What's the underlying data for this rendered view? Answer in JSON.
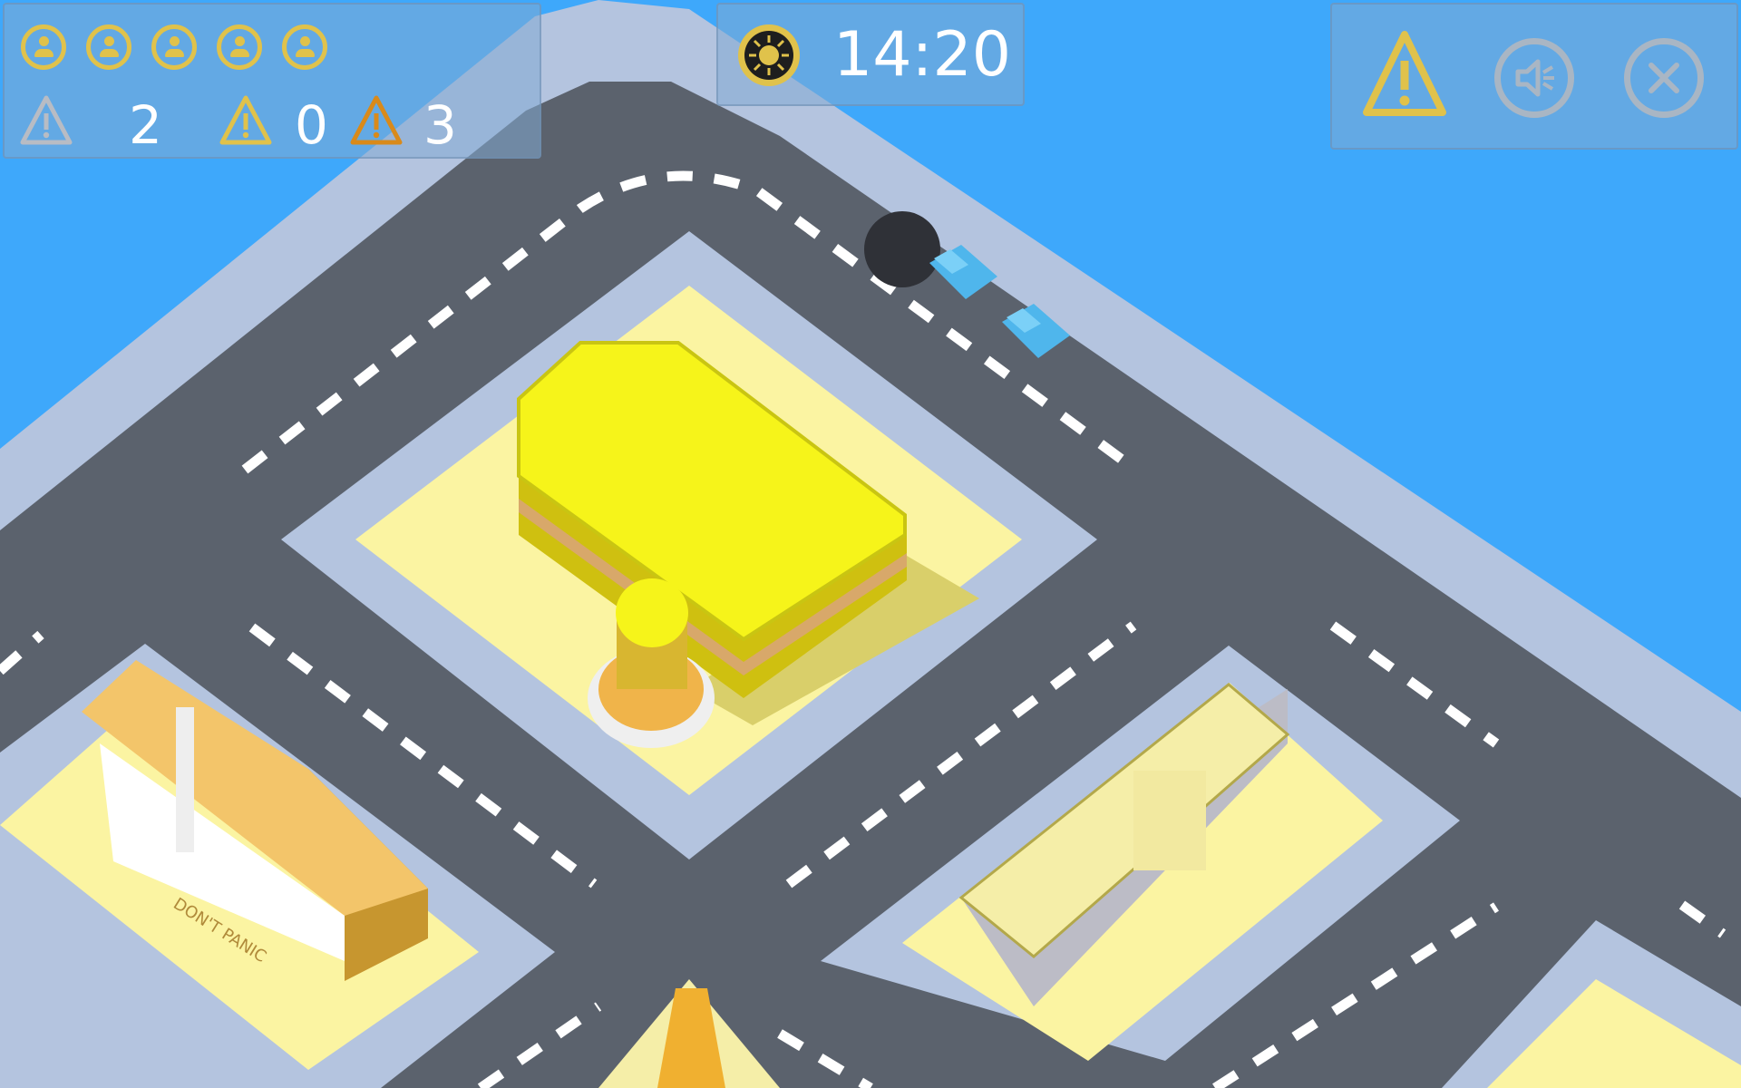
{
  "hud": {
    "citizens": [
      {
        "icon": "citizen-icon"
      },
      {
        "icon": "citizen-icon"
      },
      {
        "icon": "citizen-icon"
      },
      {
        "icon": "citizen-icon"
      },
      {
        "icon": "citizen-icon"
      }
    ],
    "alerts": {
      "low": {
        "icon": "warning-gray-icon",
        "count": "2",
        "color": "#b8bcc4"
      },
      "medium": {
        "icon": "warning-yellow-icon",
        "count": "0",
        "color": "#e0c24b"
      },
      "high": {
        "icon": "warning-orange-icon",
        "count": "3",
        "color": "#d98a1a"
      }
    },
    "clock": {
      "icon": "sun-icon",
      "time": "14:20"
    },
    "buttons": {
      "alert": {
        "icon": "warning-icon"
      },
      "sound": {
        "icon": "mute-icon"
      },
      "close": {
        "icon": "close-icon"
      }
    }
  },
  "map": {
    "sign_text": "DON'T PANIC",
    "colors": {
      "sky": "#3ea8fb",
      "road": "#5b626d",
      "sidewalk": "#b4c4df",
      "lot": "#fbf4a2",
      "building_yellow": "#f6f41a",
      "car": "#4fb6ec"
    }
  }
}
